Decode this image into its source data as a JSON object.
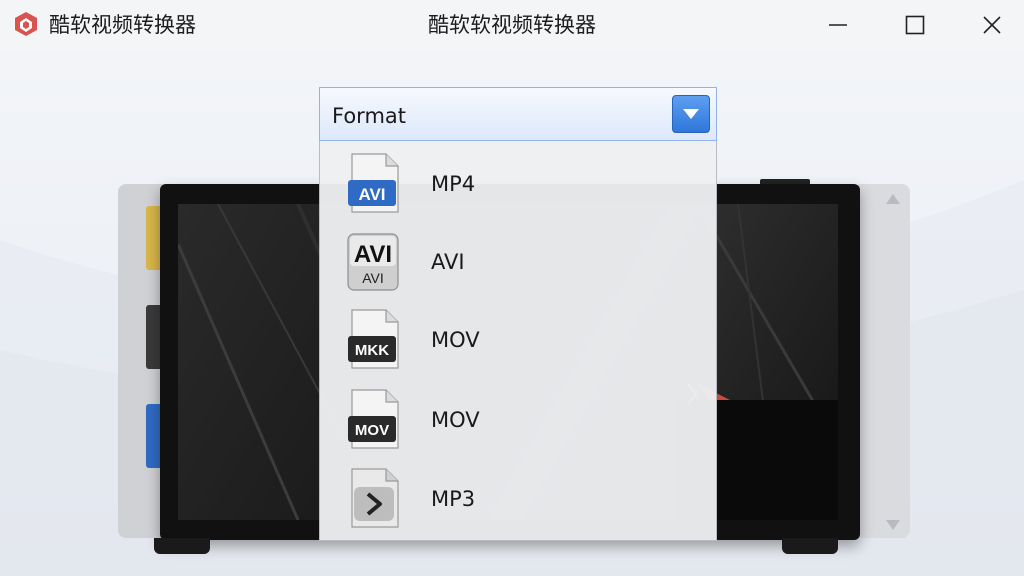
{
  "window": {
    "app_name": "酷软视频转换器",
    "title": "酷软软视频转换器",
    "controls": [
      "minimize",
      "maximize",
      "close"
    ]
  },
  "dropdown": {
    "label": "Format",
    "options": [
      {
        "label": "MP4",
        "icon_badge": "AVI",
        "icon": "avi-file-icon",
        "badge_color": "#2f6bc4"
      },
      {
        "label": "AVI",
        "icon_badge": "AVI",
        "icon_sub": "AVI",
        "icon": "avi-file-icon",
        "badge_color": "#8e8e8e"
      },
      {
        "label": "MOV",
        "icon_badge": "MKK",
        "icon": "mkk-file-icon",
        "badge_color": "#2a2a2a"
      },
      {
        "label": "MOV",
        "icon_badge": "MOV",
        "icon": "mov-file-icon",
        "badge_color": "#2a2a2a"
      },
      {
        "label": "MP3",
        "icon_badge": "",
        "icon": "play-file-icon",
        "badge_color": "#bdbdbd"
      }
    ]
  },
  "colors": {
    "accent": "#2f77db",
    "titlebar": "#f4f5f7",
    "brand": "#d9534f"
  }
}
